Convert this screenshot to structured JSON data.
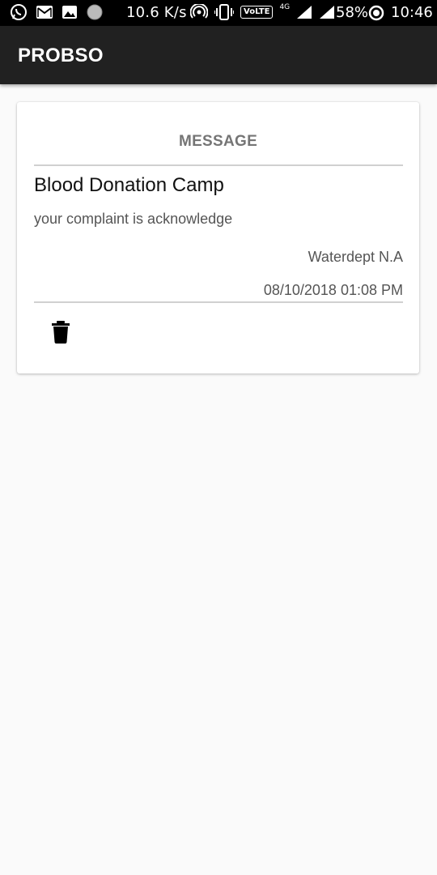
{
  "status_bar": {
    "speed": "10.6 K/s",
    "volte": "VoLTE",
    "network_type": "4G",
    "battery": "58%",
    "time": "10:46",
    "icons": [
      "whatsapp-icon",
      "gmail-icon",
      "gallery-icon",
      "circle-icon",
      "hotspot-icon",
      "vibrate-icon",
      "signal-icon",
      "battery-icon"
    ]
  },
  "app_bar": {
    "title": "PROBSO"
  },
  "card": {
    "header": "MESSAGE",
    "title": "Blood Donation Camp",
    "body": "your complaint is acknowledge",
    "sender": "Waterdept N.A",
    "datetime": "08/10/2018 01:08 PM",
    "delete_icon": "trash-icon"
  },
  "colors": {
    "status_bar_bg": "#000000",
    "app_bar_bg": "#212121",
    "page_bg": "#fafafa",
    "card_bg": "#ffffff",
    "header_text": "#757575"
  }
}
